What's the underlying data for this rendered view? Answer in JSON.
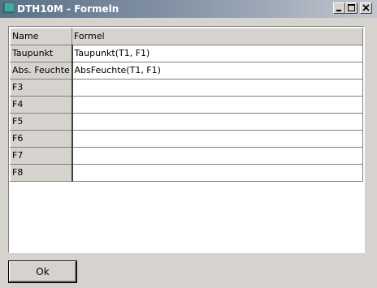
{
  "window": {
    "title": "DTH10M - Formeln",
    "icon": "app-icon",
    "controls": {
      "minimize": "minimize-icon",
      "maximize": "maximize-icon",
      "close": "close-icon"
    }
  },
  "table": {
    "headers": {
      "name": "Name",
      "formula": "Formel"
    },
    "rows": [
      {
        "name": "Taupunkt",
        "formula": "Taupunkt(T1, F1)"
      },
      {
        "name": "Abs. Feuchte",
        "formula": "AbsFeuchte(T1, F1)"
      },
      {
        "name": "F3",
        "formula": ""
      },
      {
        "name": "F4",
        "formula": ""
      },
      {
        "name": "F5",
        "formula": ""
      },
      {
        "name": "F6",
        "formula": ""
      },
      {
        "name": "F7",
        "formula": ""
      },
      {
        "name": "F8",
        "formula": ""
      }
    ]
  },
  "buttons": {
    "ok": "Ok"
  },
  "colors": {
    "face": "#d6d3ce",
    "title_start": "#5a6f86",
    "title_end": "#c2c7cf"
  }
}
